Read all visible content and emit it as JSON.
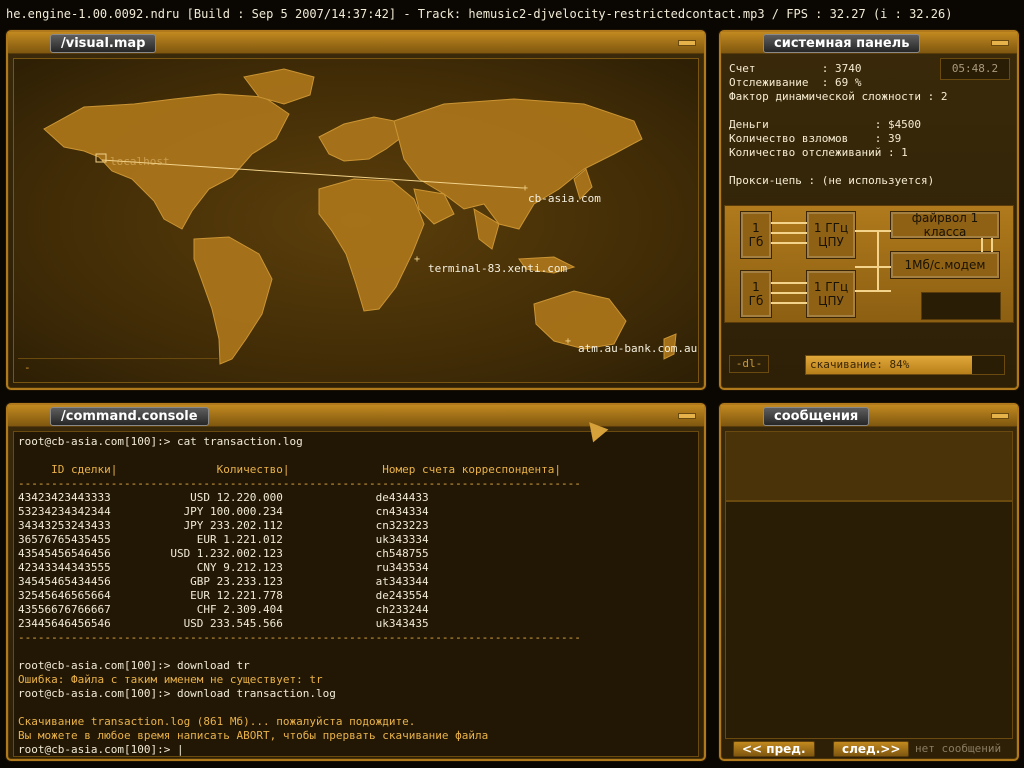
{
  "topline": "he.engine-1.00.0092.ndru [Build : Sep  5 2007/14:37:42] - Track: hemusic2-djvelocity-restrictedcontact.mp3 / FPS : 32.27 (i : 32.26)",
  "map": {
    "title": "/visual.map",
    "status": "-",
    "labels": {
      "localhost": "localhost",
      "cb_asia": "cb-asia.com",
      "terminal": "terminal-83.xenti.com",
      "atm": "atm.au-bank.com.au"
    }
  },
  "system": {
    "title": "системная панель",
    "timer": "05:48.2",
    "stats": [
      "Счет          : 3740",
      "Отслеживание  : 69 %",
      "Фактор динамической сложности : 2",
      "",
      "Деньги                : $4500",
      "Количество взломов    : 39",
      "Количество отслеживаний : 1",
      "",
      "Прокси-цепь : (не используется)"
    ],
    "hardware": {
      "mem1": "1\nГб",
      "cpu1": "1 ГГц\nЦПУ",
      "mem2": "1\nГб",
      "cpu2": "1 ГГц\nЦПУ",
      "firewall": "файрвол 1 класса",
      "modem": "1Мб/с.модем"
    },
    "download_label": "-dl-",
    "download_text": "скачивание: 84%",
    "download_progress": 0.84
  },
  "console": {
    "title": "/command.console",
    "lines": [
      {
        "t": "root@cb-asia.com[100]:> cat transaction.log",
        "c": ""
      },
      {
        "t": "",
        "c": ""
      },
      {
        "t": "     ID сделки|               Количество|              Номер счета корреспондента|",
        "c": "hdr"
      },
      {
        "t": "-------------------------------------------------------------------------------------",
        "c": "sep"
      },
      {
        "t": "43423423443333            USD 12.220.000              de434433",
        "c": ""
      },
      {
        "t": "53234234342344           JPY 100.000.234              cn434334",
        "c": ""
      },
      {
        "t": "34343253243433           JPY 233.202.112              cn323223",
        "c": ""
      },
      {
        "t": "36576765435455             EUR 1.221.012              uk343334",
        "c": ""
      },
      {
        "t": "43545456546456         USD 1.232.002.123              ch548755",
        "c": ""
      },
      {
        "t": "42343344343555             CNY 9.212.123              ru343534",
        "c": ""
      },
      {
        "t": "34545465434456            GBP 23.233.123              at343344",
        "c": ""
      },
      {
        "t": "32545646565664            EUR 12.221.778              de243554",
        "c": ""
      },
      {
        "t": "43556676766667             CHF 2.309.404              ch233244",
        "c": ""
      },
      {
        "t": "23445646456546           USD 233.545.566              uk343435",
        "c": ""
      },
      {
        "t": "-------------------------------------------------------------------------------------",
        "c": "sep"
      },
      {
        "t": "",
        "c": ""
      },
      {
        "t": "root@cb-asia.com[100]:> download tr",
        "c": ""
      },
      {
        "t": "Ошибка: Файла с таким именем не существует: tr",
        "c": "err"
      },
      {
        "t": "root@cb-asia.com[100]:> download transaction.log",
        "c": ""
      },
      {
        "t": "",
        "c": ""
      },
      {
        "t": "Скачивание transaction.log (861 Мб)... пожалуйста подождите.",
        "c": "err"
      },
      {
        "t": "Вы можете в любое время написать ABORT, чтобы прервать скачивание файла",
        "c": "err"
      },
      {
        "t": "root@cb-asia.com[100]:> |",
        "c": ""
      }
    ]
  },
  "messages": {
    "title": "сообщения",
    "prev": "<< пред.",
    "next": "след.>>",
    "none": "нет сообщений"
  }
}
